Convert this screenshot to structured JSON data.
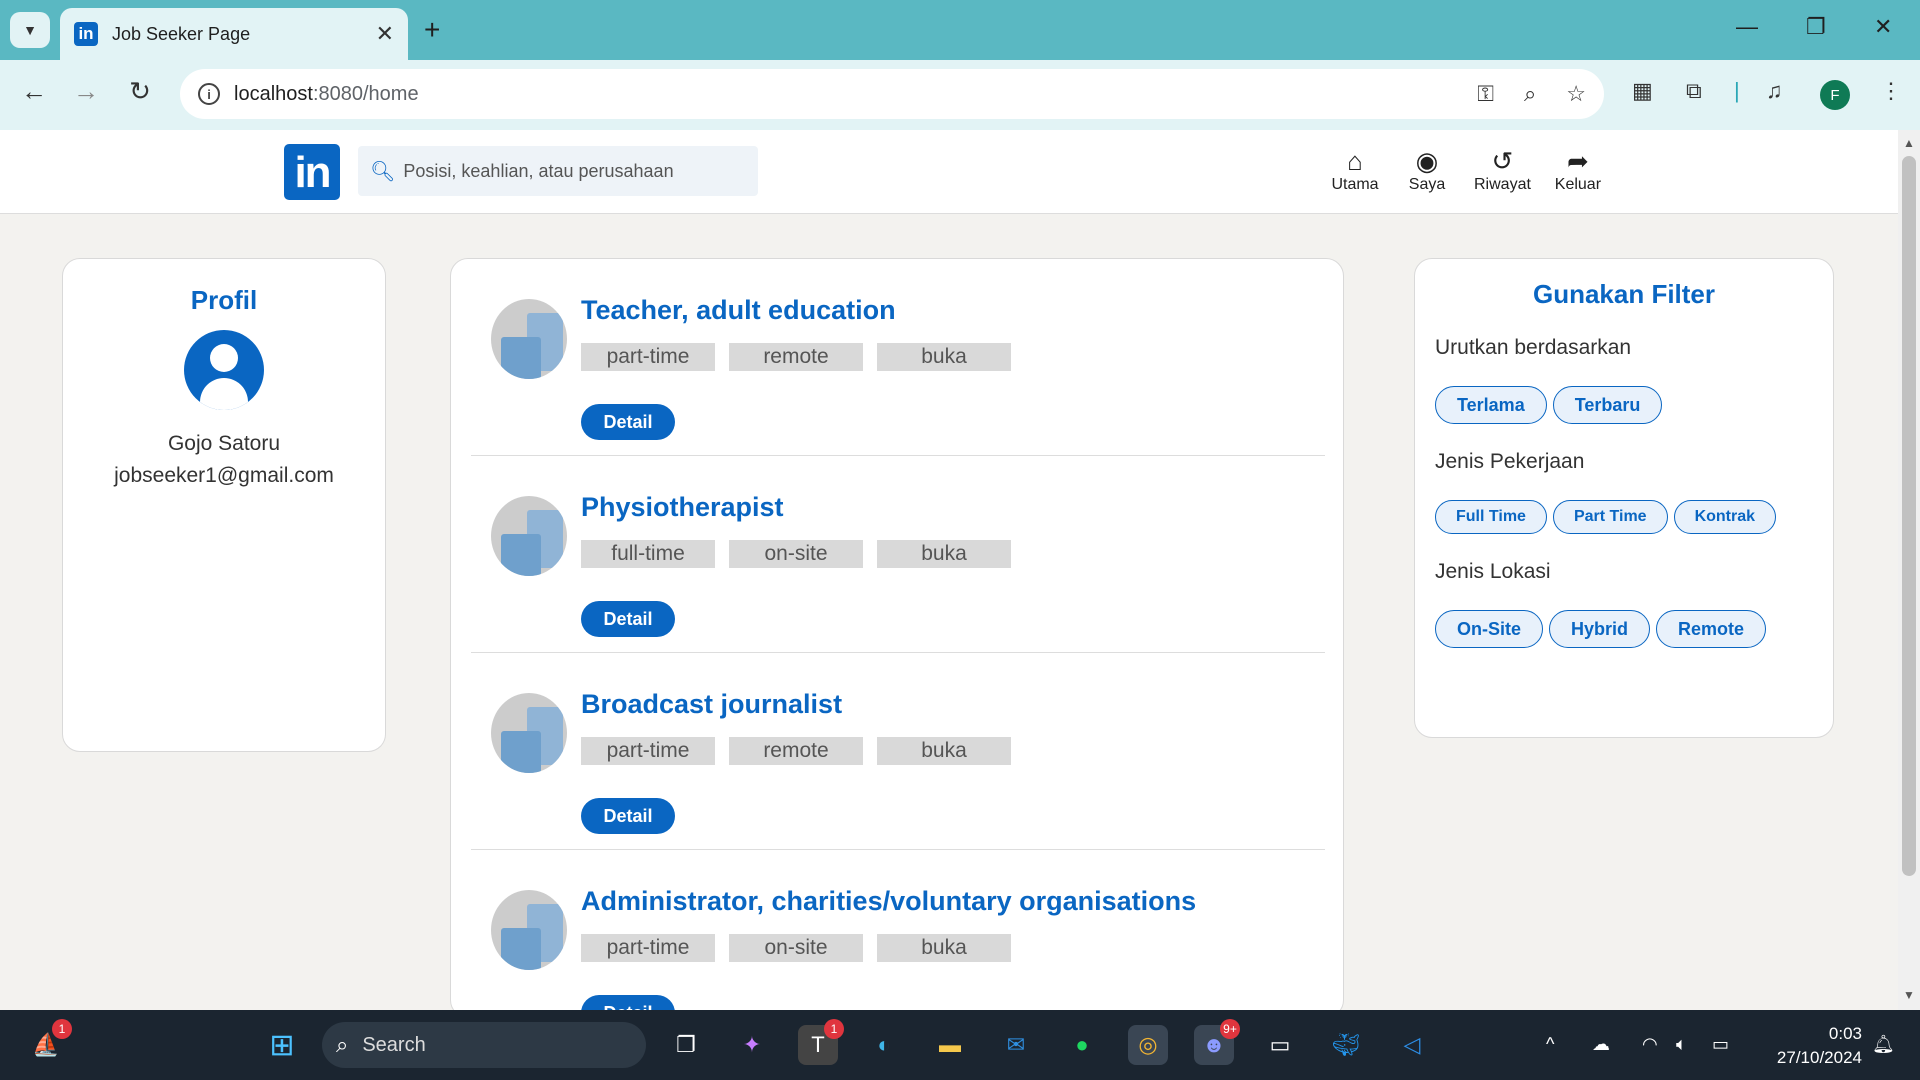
{
  "browser": {
    "tab_title": "Job Seeker Page",
    "url_host": "localhost",
    "url_path": ":8080/home",
    "profile_initial": "F"
  },
  "header": {
    "logo_text": "in",
    "search_placeholder": "Posisi, keahlian, atau perusahaan",
    "nav": [
      {
        "label": "Utama",
        "icon": "home-icon"
      },
      {
        "label": "Saya",
        "icon": "user-icon"
      },
      {
        "label": "Riwayat",
        "icon": "history-icon"
      },
      {
        "label": "Keluar",
        "icon": "logout-icon"
      }
    ]
  },
  "profile": {
    "title": "Profil",
    "name": "Gojo Satoru",
    "email": "jobseeker1@gmail.com"
  },
  "jobs": [
    {
      "title": "Teacher, adult education",
      "tags": [
        "part-time",
        "remote",
        "buka"
      ],
      "button": "Detail"
    },
    {
      "title": "Physiotherapist",
      "tags": [
        "full-time",
        "on-site",
        "buka"
      ],
      "button": "Detail"
    },
    {
      "title": "Broadcast journalist",
      "tags": [
        "part-time",
        "remote",
        "buka"
      ],
      "button": "Detail"
    },
    {
      "title": "Administrator, charities/voluntary organisations",
      "tags": [
        "part-time",
        "on-site",
        "buka"
      ],
      "button": "Detail"
    }
  ],
  "filter": {
    "title": "Gunakan Filter",
    "sort_label": "Urutkan berdasarkan",
    "sort_options": [
      "Terlama",
      "Terbaru"
    ],
    "type_label": "Jenis Pekerjaan",
    "type_options": [
      "Full Time",
      "Part Time",
      "Kontrak"
    ],
    "location_label": "Jenis Lokasi",
    "location_options": [
      "On-Site",
      "Hybrid",
      "Remote"
    ]
  },
  "taskbar": {
    "search_label": "Search",
    "time": "0:03",
    "date": "27/10/2024",
    "widgets_badge": "1",
    "teams_badge": "1",
    "discord_badge": "9+"
  },
  "colors": {
    "brand": "#0a66c2",
    "tabbar": "#5ab8c2",
    "tag_bg": "#d9d9d9"
  }
}
